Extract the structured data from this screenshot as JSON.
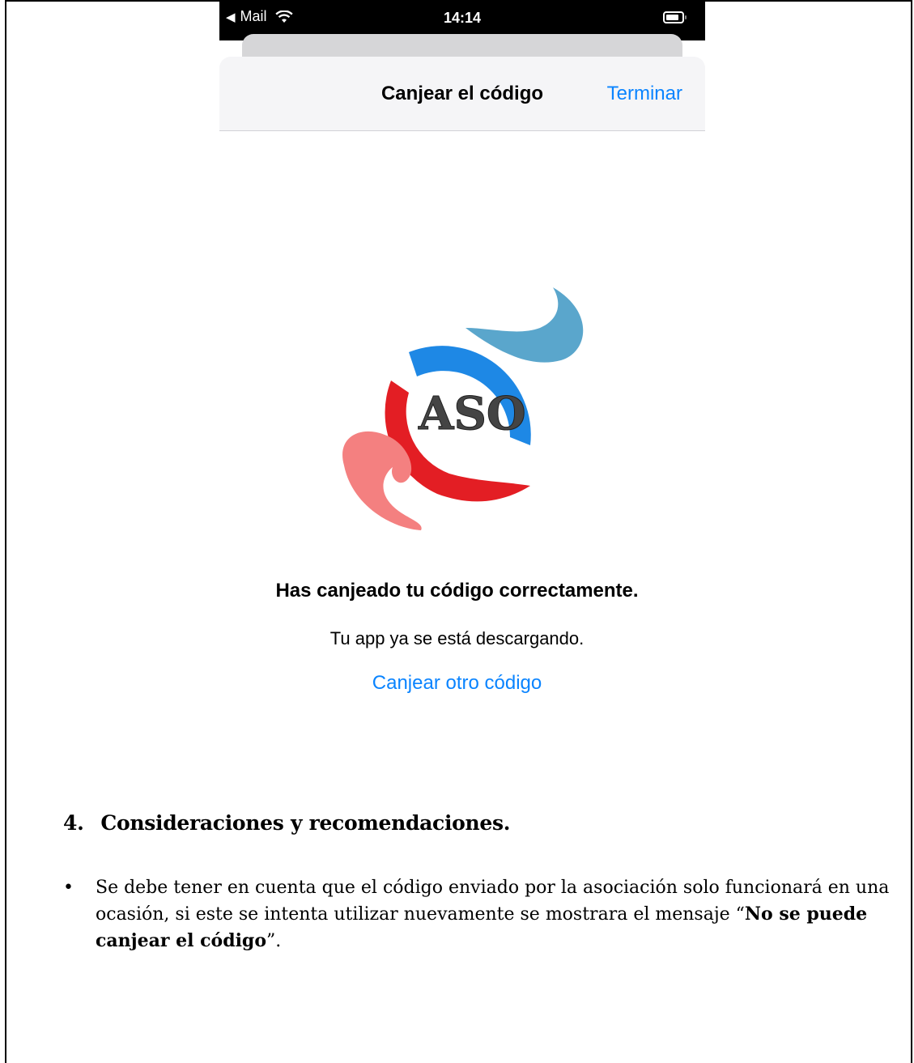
{
  "status_bar": {
    "back_label": "Mail",
    "time": "14:14"
  },
  "nav": {
    "title": "Canjear el código",
    "done_label": "Terminar"
  },
  "logo": {
    "text": "ASO"
  },
  "success": {
    "title": "Has canjeado tu código correctamente.",
    "subtitle": "Tu app ya se está descargando.",
    "redeem_another": "Canjear otro código"
  },
  "document": {
    "section_number": "4.",
    "section_title": "Consideraciones y recomendaciones.",
    "bullet_part1": "Se debe tener en cuenta que el código enviado por la asociación solo funcionará en una ocasión, si este se intenta utilizar nuevamente se mostrara el mensaje “",
    "bullet_bold": "No se puede canjear el código",
    "bullet_part2": "”."
  },
  "colors": {
    "accent_blue": "#0a84ff",
    "logo_blue": "#1e88e5",
    "logo_red": "#e31e24",
    "logo_pink": "#f48080",
    "logo_teal": "#5aa6cc"
  }
}
